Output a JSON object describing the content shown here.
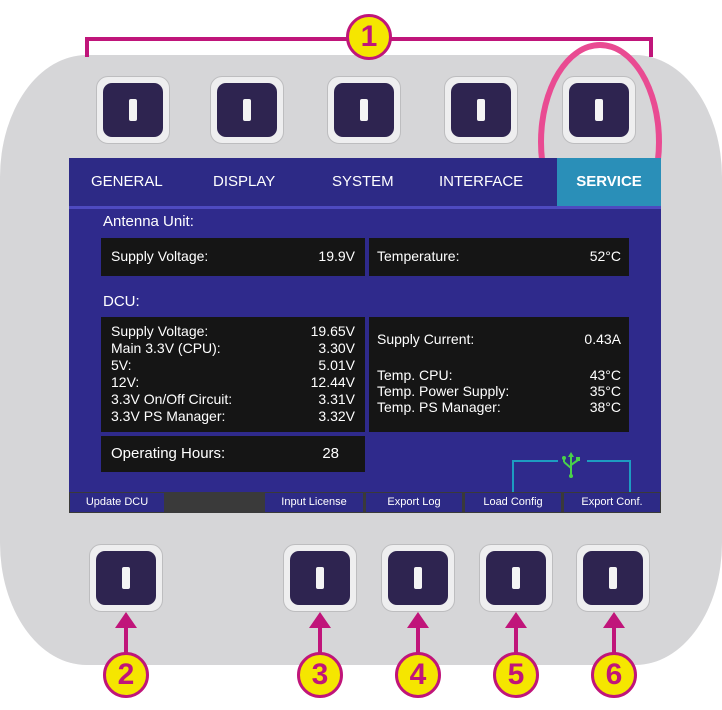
{
  "tabs": [
    {
      "label": "GENERAL",
      "active": false
    },
    {
      "label": "DISPLAY",
      "active": false
    },
    {
      "label": "SYSTEM",
      "active": false
    },
    {
      "label": "INTERFACE",
      "active": false
    },
    {
      "label": "SERVICE",
      "active": true
    }
  ],
  "antenna": {
    "heading": "Antenna Unit:",
    "supply_voltage_label": "Supply Voltage:",
    "supply_voltage_value": "19.9V",
    "temperature_label": "Temperature:",
    "temperature_value": "52°C"
  },
  "dcu": {
    "heading": "DCU:",
    "voltages": [
      {
        "label": "Supply Voltage:",
        "value": "19.65V"
      },
      {
        "label": "Main 3.3V (CPU):",
        "value": "3.30V"
      },
      {
        "label": "5V:",
        "value": "5.01V"
      },
      {
        "label": "12V:",
        "value": "12.44V"
      },
      {
        "label": "3.3V On/Off Circuit:",
        "value": "3.31V"
      },
      {
        "label": "3.3V PS Manager:",
        "value": "3.32V"
      }
    ],
    "supply_current_label": "Supply Current:",
    "supply_current_value": "0.43A",
    "temps": [
      {
        "label": "Temp. CPU:",
        "value": "43°C"
      },
      {
        "label": "Temp. Power Supply:",
        "value": "35°C"
      },
      {
        "label": "Temp. PS Manager:",
        "value": "38°C"
      }
    ],
    "operating_hours_label": "Operating Hours:",
    "operating_hours_value": "28"
  },
  "softkeys": [
    "Update DCU",
    "Input License",
    "Export Log",
    "Load Config",
    "Export Conf."
  ],
  "usb_symbol": "usb-icon",
  "callouts": [
    "1",
    "2",
    "3",
    "4",
    "5",
    "6"
  ],
  "colors": {
    "accent": "#c0157a",
    "callout_fill": "#f5e600",
    "highlight": "#e94b92",
    "screen_bg": "#2f2a8c",
    "active_tab": "#2a8fb8"
  }
}
